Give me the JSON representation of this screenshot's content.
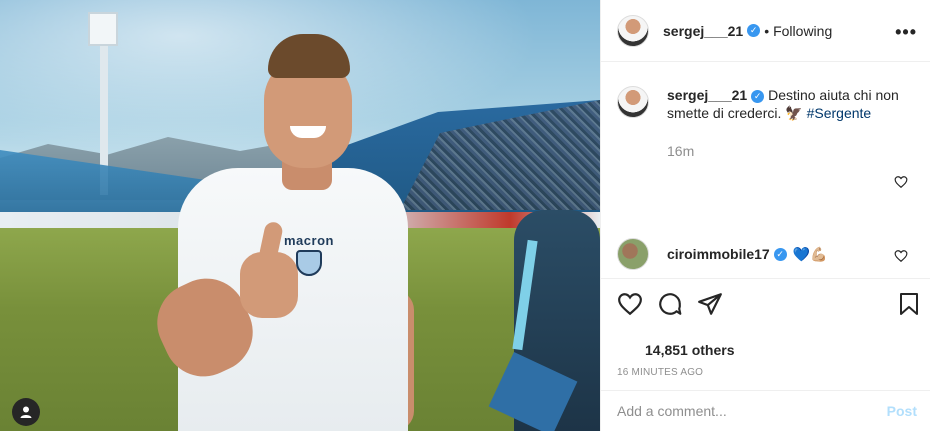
{
  "post": {
    "username": "sergej___21",
    "follow_status": "Following",
    "more_glyph": "•••",
    "caption_text": "Destino aiuta chi non smette di crederci. 🦅 ",
    "caption_hashtag": "#Sergente",
    "time_ago": "16m",
    "photo_brand": "macron"
  },
  "comments": [
    {
      "username": "ciroimmobile17",
      "text": "💙💪🏼"
    }
  ],
  "likes": {
    "text": "14,851 others"
  },
  "timestamp": "16 MINUTES AGO",
  "add_comment": {
    "placeholder": "Add a comment...",
    "post_label": "Post"
  },
  "colors": {
    "verified": "#3897f0",
    "hashtag": "#00376b",
    "post_disabled": "#b2dffc",
    "muted": "#8e8e8e"
  },
  "icons": [
    "verified-icon",
    "more-icon",
    "heart-icon",
    "comment-icon",
    "share-icon",
    "bookmark-icon",
    "user-tag-icon"
  ]
}
